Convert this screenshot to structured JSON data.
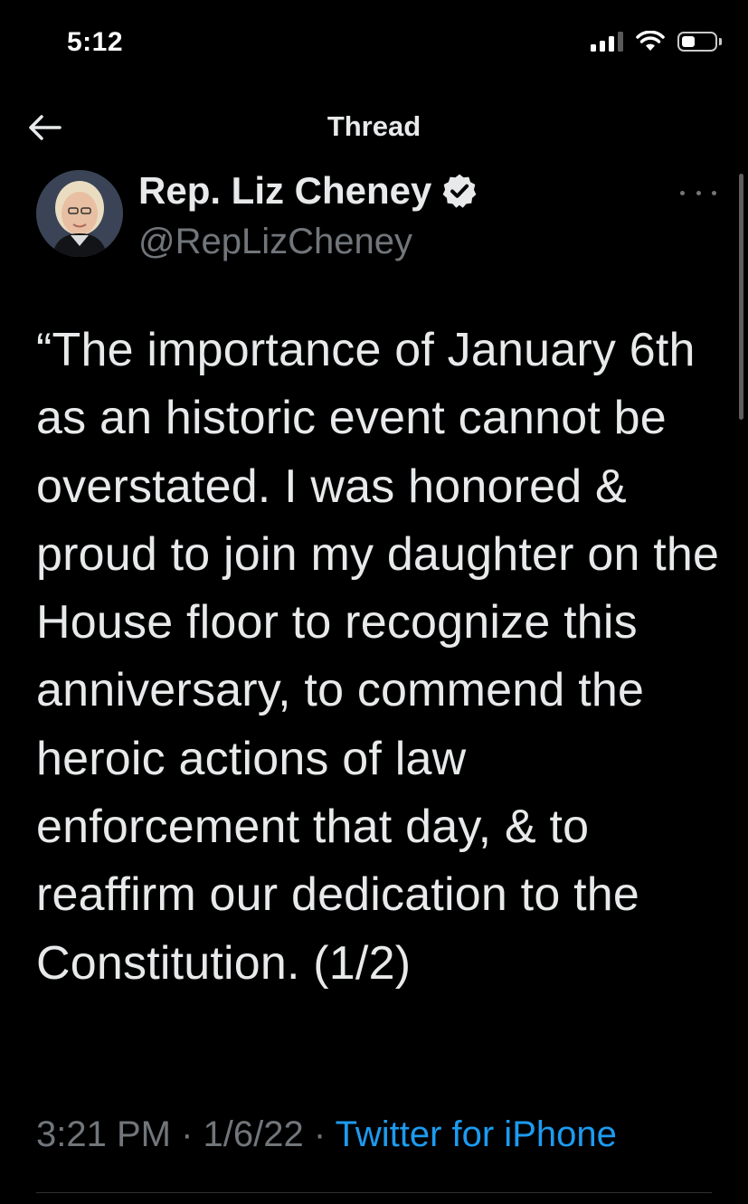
{
  "status_bar": {
    "time": "5:12",
    "icons": [
      "signal-icon",
      "wifi-icon",
      "battery-icon"
    ]
  },
  "nav": {
    "back_icon": "arrow-left-icon",
    "title": "Thread"
  },
  "tweet": {
    "author": {
      "name": "Rep. Liz Cheney",
      "handle": "@RepLizCheney",
      "verified": true,
      "avatar_icon": "profile-photo"
    },
    "more_icon": "ellipsis-icon",
    "text": "“The importance of January 6th as an historic event cannot be overstated. I was honored & proud to join my daughter on the House floor to recognize this anniversary, to commend the heroic actions of law enforcement that day, & to reaffirm our dedication to the Constitution. (1/2)",
    "time": "3:21 PM",
    "separator": "·",
    "date": "1/6/22",
    "source": "Twitter for iPhone"
  },
  "colors": {
    "background": "#000000",
    "text_primary": "#e7e9ea",
    "text_secondary": "#71767b",
    "link": "#1d9bf0",
    "divider": "#2f3336"
  }
}
